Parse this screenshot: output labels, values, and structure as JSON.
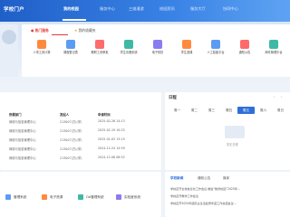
{
  "header": {
    "logo": "学校门户",
    "nav": [
      "我的校园",
      "服务中心",
      "三维漫游",
      "校园资讯",
      "服务大厅",
      "协同中心"
    ]
  },
  "quick": {
    "tabs": [
      "热门服务",
      "我的收藏夹"
    ],
    "tiles": [
      {
        "label": "人事工资计算",
        "color": "#ff8a3d"
      },
      {
        "label": "课程登记表",
        "color": "#5b9cf3"
      },
      {
        "label": "教职工资审批",
        "color": "#ff6b6b"
      },
      {
        "label": "学生请假系统",
        "color": "#3fb9a6"
      },
      {
        "label": "电子校历",
        "color": "#8b7bf0"
      },
      {
        "label": "学生选课",
        "color": "#ff8a3d"
      },
      {
        "label": "人工智能平台",
        "color": "#5b9cf3"
      },
      {
        "label": "通知公告",
        "color": "#ff6b6b"
      },
      {
        "label": "邮件管理平台",
        "color": "#3fb9a6"
      }
    ]
  },
  "tasks": {
    "headers": [
      "所属部门",
      "发起人",
      "申请时间"
    ],
    "rows": [
      {
        "dept": "网络与信息管理中心",
        "user": "213007(方)(学)",
        "time": "2025-02-26 14:13"
      },
      {
        "dept": "网络与信息管理中心",
        "user": "213007(方)(学)",
        "time": "2025-02-19 10:25"
      },
      {
        "dept": "网络与信息管理中心",
        "user": "213007(方)(学)",
        "time": "2025-01-03 13:19"
      },
      {
        "dept": "网络与信息管理中心",
        "user": "213007(方)(学)",
        "time": "2024-12-24 14:59"
      },
      {
        "dept": "网络与信息管理中心",
        "user": "213007(方)(学)",
        "time": "2024-12-06 08:52"
      }
    ]
  },
  "calendar": {
    "title": "日程",
    "days": [
      "周一",
      "周二",
      "周三",
      "周四",
      "周五",
      "周六",
      "周日"
    ],
    "active_index": 4,
    "empty_text": "暂无日程"
  },
  "systems": [
    {
      "label": "管理系统",
      "color": "#5b9cf3"
    },
    {
      "label": "电子资源",
      "color": "#ff8a3d"
    },
    {
      "label": "OA管理系统",
      "color": "#3fb9a6"
    },
    {
      "label": "实验室系统",
      "color": "#8b7bf0"
    }
  ],
  "news": {
    "tabs": [
      "学校新闻",
      "通知公告",
      "媒体"
    ],
    "items": [
      "学校召开全校信息化工作会议 推进“数智校园”2025年...",
      "学校召开教学工作会议",
      "学校召开2024年度民主生活会暨年度工作总结会议..."
    ]
  }
}
